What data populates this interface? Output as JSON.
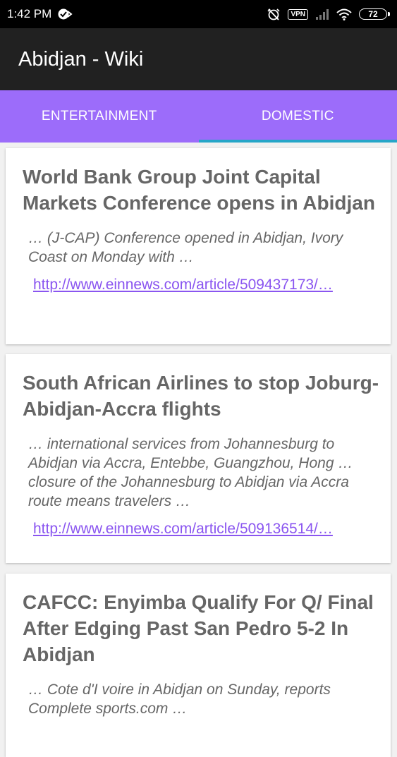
{
  "status_bar": {
    "time": "1:42 PM",
    "vpn_label": "VPN",
    "battery_level": "72"
  },
  "app_bar": {
    "title": "Abidjan - Wiki"
  },
  "tabs": [
    {
      "label": "ENTERTAINMENT",
      "selected": false
    },
    {
      "label": "DOMESTIC",
      "selected": true
    }
  ],
  "colors": {
    "accent": "#9c6cfa",
    "indicator": "#26a6c8",
    "link": "#8a55f0"
  },
  "articles": [
    {
      "title": "World Bank Group Joint Capital Markets Conference opens in Abidjan",
      "snippet": "… (J-CAP)  Conference opened in Abidjan, Ivory Coast on Monday with …",
      "link": "http://www.einnews.com/article/509437173/…"
    },
    {
      "title": "South African Airlines to stop Joburg-Abidjan-Accra flights",
      "snippet": "… international services from Johannesburg to Abidjan via Accra, Entebbe, Guangzhou, Hong … closure of the Johannesburg to Abidjan via Accra route means travelers …",
      "link": "http://www.einnews.com/article/509136514/…"
    },
    {
      "title": "CAFCC: Enyimba Qualify For Q/ Final After Edging Past San Pedro 5-2  In Abidjan",
      "snippet": "… Cote d'I voire in Abidjan on Sunday, reports Complete sports.com …",
      "link": ""
    }
  ]
}
